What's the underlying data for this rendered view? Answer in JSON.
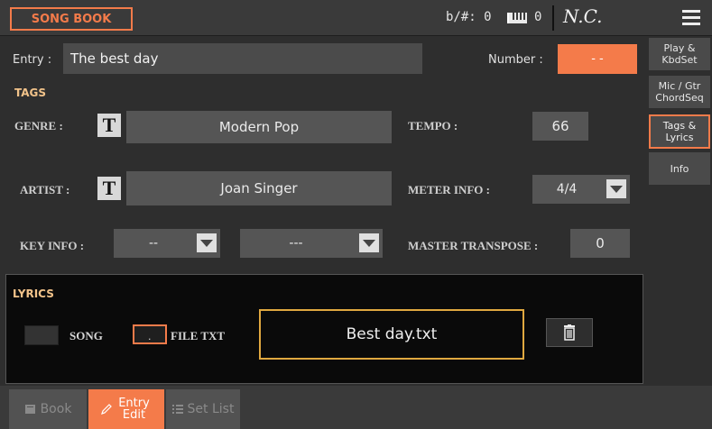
{
  "header": {
    "title": "SONG BOOK",
    "flat_sharp": "b/#: 0",
    "keyboard_value": "0",
    "chord": "N.C."
  },
  "entry": {
    "label": "Entry :",
    "value": "The best day",
    "number_label": "Number :",
    "number_value": "- -"
  },
  "tags": {
    "section_label": "TAGS",
    "genre_label": "GENRE :",
    "genre_value": "Modern Pop",
    "tempo_label": "TEMPO :",
    "tempo_value": "66",
    "artist_label": "ARTIST :",
    "artist_value": "Joan Singer",
    "meter_label": "METER INFO :",
    "meter_value": "4/4",
    "key_label": "KEY INFO :",
    "key_value_1": "--",
    "key_value_2": "---",
    "transpose_label": "MASTER TRANSPOSE :",
    "transpose_value": "0",
    "t_button": "T"
  },
  "lyrics": {
    "section_label": "LYRICS",
    "song_label": "SONG",
    "filetxt_label": "FILE TXT",
    "file_value": "Best day.txt"
  },
  "side_tabs": [
    {
      "label": "Play & KbdSet"
    },
    {
      "label": "Mic / Gtr ChordSeq"
    },
    {
      "label": "Tags & Lyrics"
    },
    {
      "label": "Info"
    }
  ],
  "bottom_tabs": [
    {
      "label": "Book",
      "icon": "book-icon"
    },
    {
      "label": "Entry Edit",
      "icon": "pencil-icon"
    },
    {
      "label": "Set List",
      "icon": "list-icon"
    }
  ],
  "colors": {
    "accent": "#f47b4a",
    "highlight": "#e0a840",
    "section": "#f2c38a"
  }
}
